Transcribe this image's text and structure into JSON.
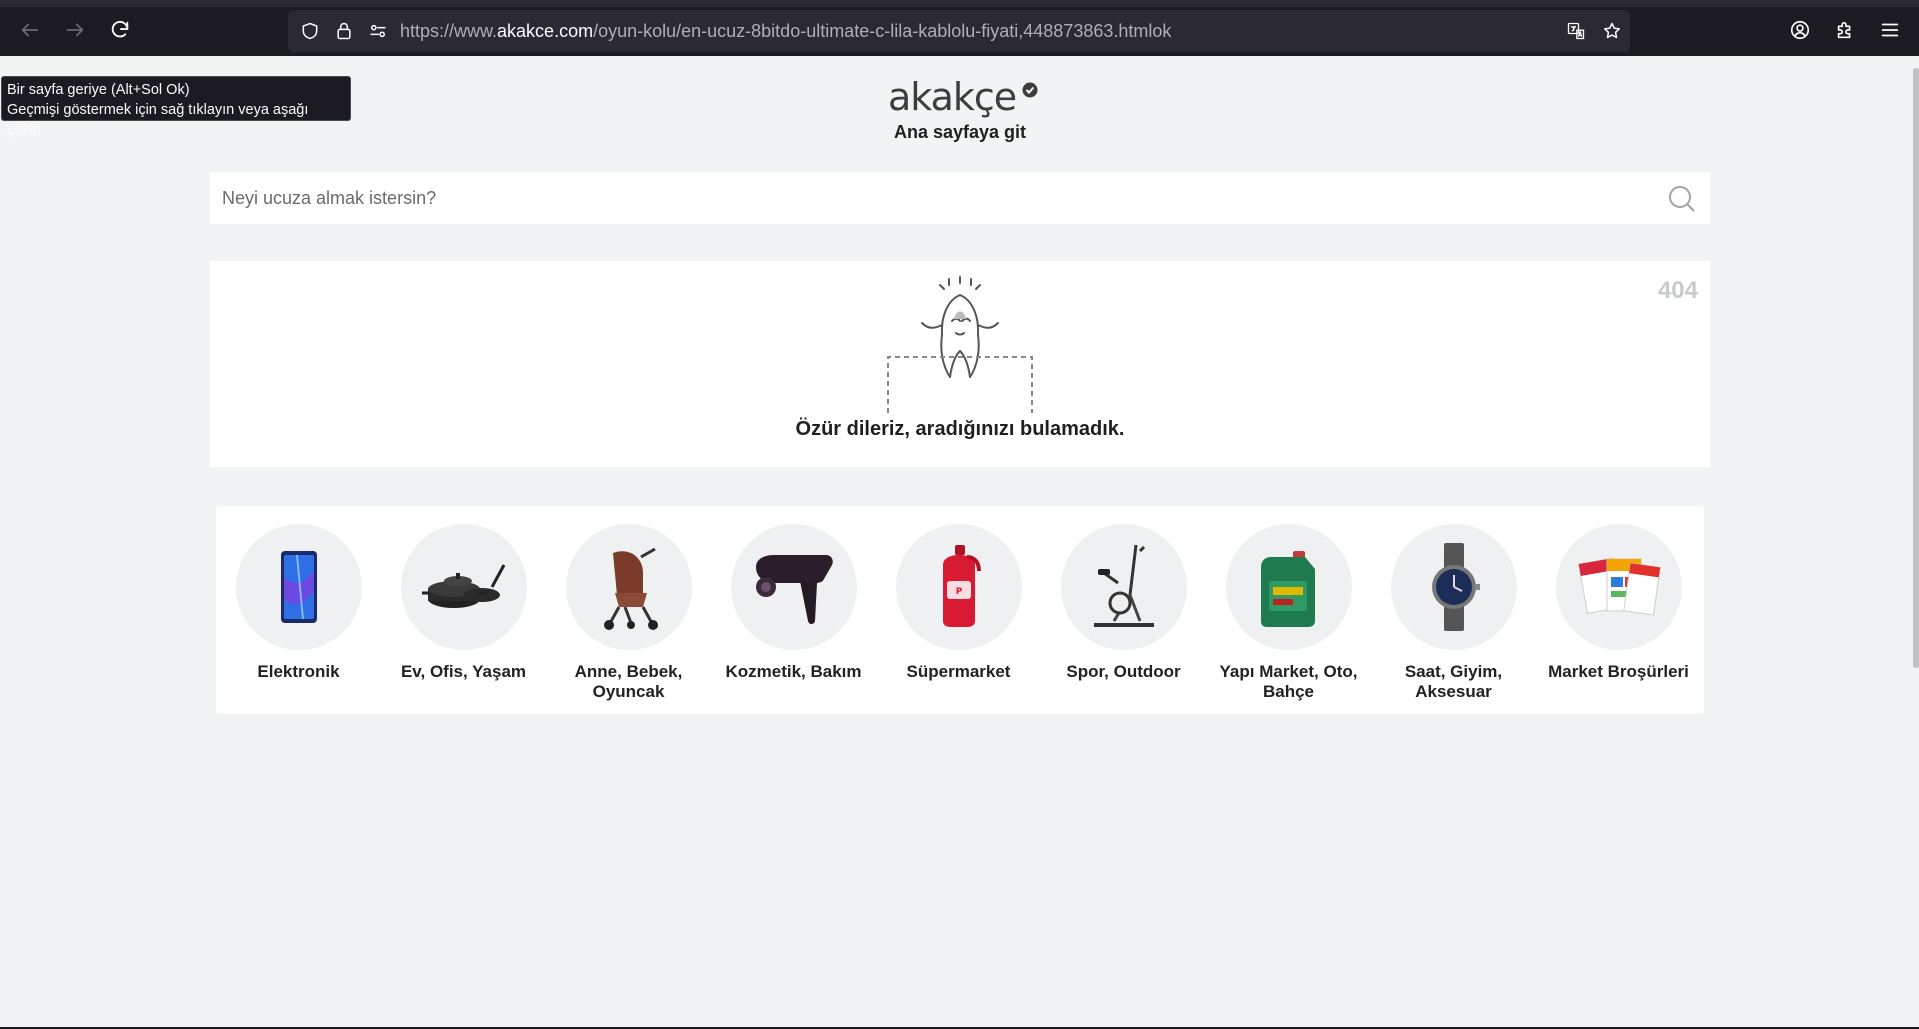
{
  "browser": {
    "url_prefix": "https://www.",
    "url_host": "akakce.com",
    "url_path": "/oyun-kolu/en-ucuz-8bitdo-ultimate-c-lila-kablolu-fiyati,448873863.htmlok"
  },
  "tooltip": {
    "line1": "Bir sayfa geriye (Alt+Sol Ok)",
    "line2": "Geçmişi göstermek için sağ tıklayın veya aşağı çekin"
  },
  "header": {
    "logo_text": "akakçe",
    "home_link": "Ana sayfaya git"
  },
  "search": {
    "placeholder": "Neyi ucuza almak istersin?",
    "value": ""
  },
  "error": {
    "code": "404",
    "message": "Özür dileriz, aradığınızı bulamadık."
  },
  "categories": [
    {
      "label": "Elektronik",
      "icon": "smartphone-icon"
    },
    {
      "label": "Ev, Ofis, Yaşam",
      "icon": "cookware-icon"
    },
    {
      "label": "Anne, Bebek, Oyuncak",
      "icon": "stroller-icon"
    },
    {
      "label": "Kozmetik, Bakım",
      "icon": "hair-dryer-icon"
    },
    {
      "label": "Süpermarket",
      "icon": "detergent-icon"
    },
    {
      "label": "Spor, Outdoor",
      "icon": "elliptical-trainer-icon"
    },
    {
      "label": "Yapı Market, Oto, Bahçe",
      "icon": "motor-oil-icon"
    },
    {
      "label": "Saat, Giyim, Aksesuar",
      "icon": "wristwatch-icon"
    },
    {
      "label": "Market Broşürleri",
      "icon": "brochure-icon"
    }
  ],
  "colors": {
    "chrome_bg": "#1c1b22",
    "urlbar_bg": "#2b2a33",
    "page_bg": "#f2f3f5"
  }
}
